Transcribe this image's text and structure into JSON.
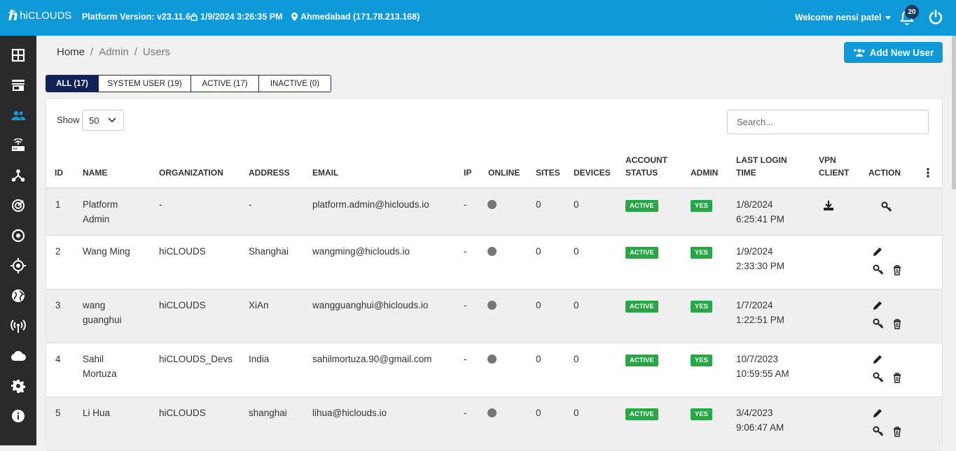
{
  "header": {
    "logo_text": "hiCLOUDS",
    "platform_version": "Platform Version: v23.11.6",
    "datetime": "1/9/2024 3:26:35 PM",
    "location": "Ahmedabad (171.78.213.168)",
    "welcome": "Welcome nensi patel",
    "notification_count": "20"
  },
  "sidebar": {
    "items": [
      "dashboard-icon",
      "store-icon",
      "users-icon",
      "router-icon",
      "network-icon",
      "radar-icon",
      "target-icon",
      "crosshair-icon",
      "globe-icon",
      "wifi-tower-icon",
      "cloud-icon",
      "gear-icon",
      "info-icon"
    ],
    "active_index": 2,
    "active_color": "#0e9ad8"
  },
  "breadcrumb": {
    "home": "Home",
    "sep": "/",
    "admin": "Admin",
    "users": "Users"
  },
  "add_button": "Add New User",
  "tabs": [
    {
      "label": "ALL (17)",
      "active": true
    },
    {
      "label": "SYSTEM USER (19)",
      "active": false
    },
    {
      "label": "ACTIVE (17)",
      "active": false
    },
    {
      "label": "INACTIVE (0)",
      "active": false
    }
  ],
  "show": {
    "label": "Show",
    "value": "50"
  },
  "search": {
    "placeholder": "Search..."
  },
  "columns": {
    "id": "ID",
    "name": "NAME",
    "organization": "ORGANIZATION",
    "address": "ADDRESS",
    "email": "EMAIL",
    "ip": "IP",
    "online": "ONLINE",
    "sites": "SITES",
    "devices": "DEVICES",
    "account_status_1": "ACCOUNT",
    "account_status_2": "STATUS",
    "admin": "ADMIN",
    "last_login_1": "LAST LOGIN",
    "last_login_2": "TIME",
    "vpn_1": "VPN",
    "vpn_2": "CLIENT",
    "action": "ACTION"
  },
  "rows": [
    {
      "id": "1",
      "name1": "Platform",
      "name2": "Admin",
      "org": "-",
      "address": "-",
      "email": "platform.admin@hiclouds.io",
      "ip": "-",
      "sites": "0",
      "devices": "0",
      "status": "ACTIVE",
      "admin": "YES",
      "login1": "1/8/2024",
      "login2": "6:25:41 PM"
    },
    {
      "id": "2",
      "name1": "Wang Ming",
      "name2": "",
      "org": "hiCLOUDS",
      "address": "Shanghai",
      "email": "wangming@hiclouds.io",
      "ip": "-",
      "sites": "0",
      "devices": "0",
      "status": "ACTIVE",
      "admin": "YES",
      "login1": "1/9/2024",
      "login2": "2:33:30 PM"
    },
    {
      "id": "3",
      "name1": "wang",
      "name2": "guanghui",
      "org": "hiCLOUDS",
      "address": "XiAn",
      "email": "wangguanghui@hiclouds.io",
      "ip": "-",
      "sites": "0",
      "devices": "0",
      "status": "ACTIVE",
      "admin": "YES",
      "login1": "1/7/2024",
      "login2": "1:22:51 PM"
    },
    {
      "id": "4",
      "name1": "Sahil",
      "name2": "Mortuza",
      "org": "hiCLOUDS_Devs",
      "address": "India",
      "email": "sahilmortuza.90@gmail.com",
      "ip": "-",
      "sites": "0",
      "devices": "0",
      "status": "ACTIVE",
      "admin": "YES",
      "login1": "10/7/2023",
      "login2": "10:59:55 AM"
    },
    {
      "id": "5",
      "name1": "Li Hua",
      "name2": "",
      "org": "hiCLOUDS",
      "address": "shanghai",
      "email": "lihua@hiclouds.io",
      "ip": "-",
      "sites": "0",
      "devices": "0",
      "status": "ACTIVE",
      "admin": "YES",
      "login1": "3/4/2023",
      "login2": "9:06:47 AM"
    }
  ]
}
